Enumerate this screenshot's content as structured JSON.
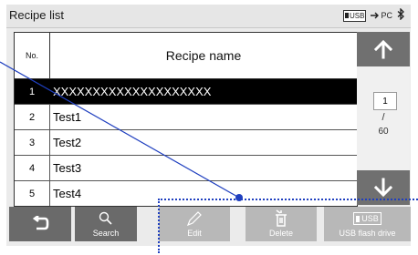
{
  "window": {
    "title": "Recipe list"
  },
  "status": {
    "usb_label": "USB",
    "pc_label": "PC"
  },
  "table": {
    "headers": {
      "no": "No.",
      "name": "Recipe name"
    },
    "rows": [
      {
        "no": "1",
        "name": "XXXXXXXXXXXXXXXXXXXX",
        "selected": true
      },
      {
        "no": "2",
        "name": "Test1"
      },
      {
        "no": "3",
        "name": "Test2"
      },
      {
        "no": "4",
        "name": "Test3"
      },
      {
        "no": "5",
        "name": "Test4"
      }
    ]
  },
  "pager": {
    "current": "1",
    "separator": "/",
    "total": "60"
  },
  "toolbar": {
    "search_label": "Search",
    "edit_label": "Edit",
    "delete_label": "Delete",
    "usb_label": "USB flash drive",
    "usb_badge": "USB"
  },
  "icons": [
    "back-arrow-icon",
    "search-icon",
    "pencil-icon",
    "trash-icon",
    "usb-icon",
    "bluetooth-icon",
    "arrow-up-icon",
    "arrow-down-icon"
  ],
  "colors": {
    "button": "#6a6a6a",
    "button_disabled": "#b8b8b8",
    "selected_row": "#000000",
    "callout": "#1f3fbf"
  }
}
